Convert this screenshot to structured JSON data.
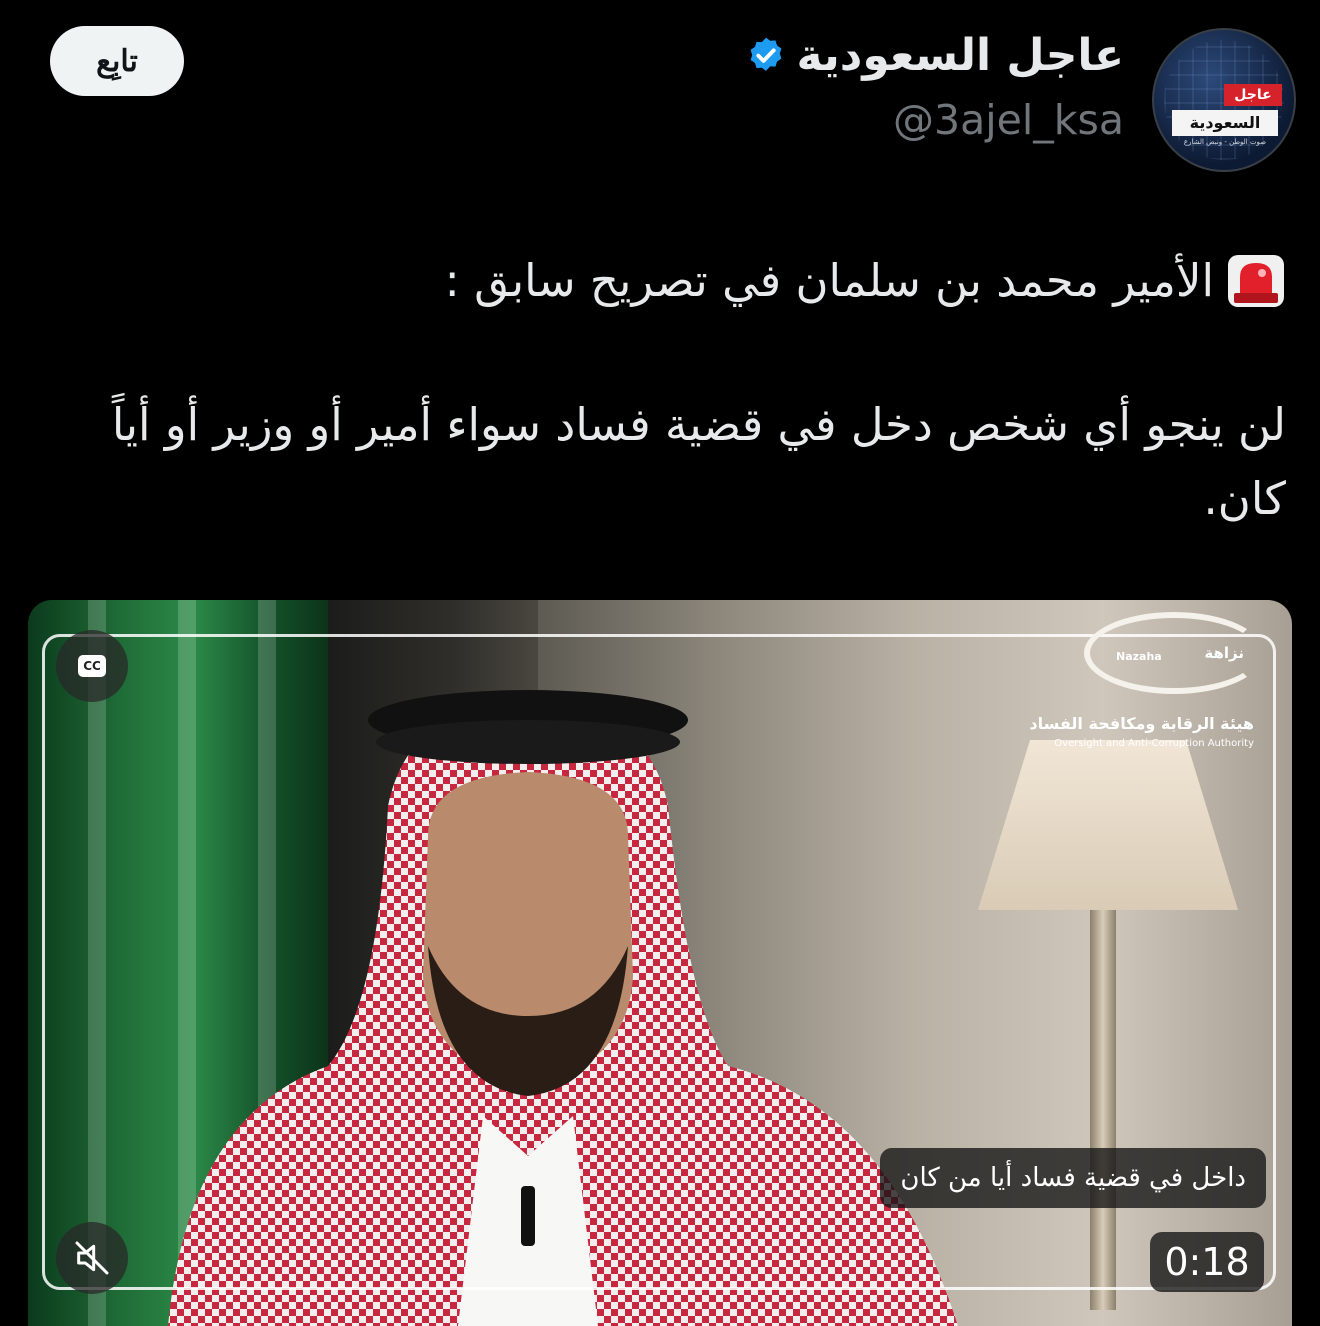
{
  "account": {
    "avatar_badge_top": "عاجل",
    "avatar_badge_main": "السعودية",
    "avatar_badge_sub": "صوت الوطن - ونبض الشارع",
    "display_name": "عاجل السعودية",
    "handle": "@3ajel_ksa",
    "verified": true,
    "verified_color": "#1d9bf0"
  },
  "follow_button": {
    "label": "تابِع"
  },
  "tweet": {
    "emoji_icon": "rotating-light-icon",
    "line1": "الأمير محمد بن سلمان في تصريح سابق :",
    "line2": "لن ينجو أي شخص دخل في قضية فساد سواء أمير أو وزير أو أياً كان."
  },
  "video": {
    "logo_word_ar": "نزاهة",
    "logo_word_en": "Nazaha",
    "logo_title_ar": "هيئة الرقابة ومكافحة الفساد",
    "logo_title_en": "Oversight and Anti-Corruption Authority",
    "cc_label": "CC",
    "caption": "داخل في قضية فساد أيا من كان",
    "duration": "0:18",
    "muted": true
  },
  "colors": {
    "background": "#000000",
    "text": "#e7e9ea",
    "muted_text": "#71767b",
    "follow_bg": "#eff3f4"
  }
}
